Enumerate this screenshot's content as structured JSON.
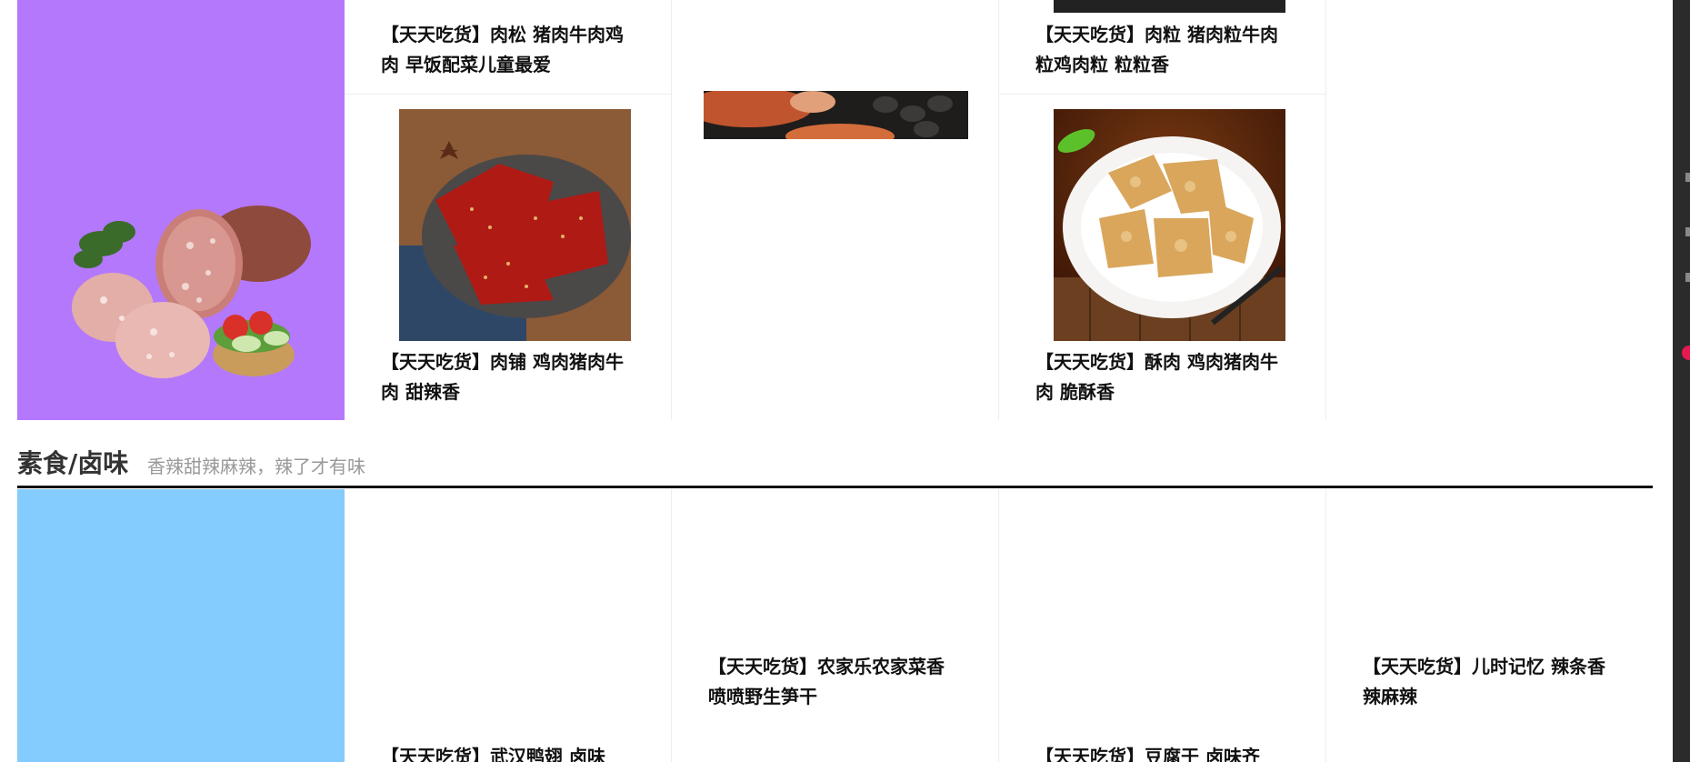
{
  "colors": {
    "promo_purple": "#b478fd",
    "promo_blue": "#84ccfd",
    "divider": "#111111",
    "subtitle_gray": "#999999"
  },
  "meat_section": {
    "products": [
      {
        "title": "【天天吃货】肉松 猪肉牛肉鸡肉 早饭配菜儿童最爱"
      },
      {
        "title": "【天天吃货】肉粒 猪肉粒牛肉粒鸡肉粒 粒粒香"
      },
      {
        "title": "【天天吃货】肉铺 鸡肉猪肉牛肉 甜辣香"
      },
      {
        "title": "【天天吃货】酥肉 鸡肉猪肉牛肉 脆酥香"
      }
    ]
  },
  "veg_section": {
    "title": "素食/卤味",
    "subtitle": "香辣甜辣麻辣，辣了才有味",
    "products": [
      {
        "title": "【天天吃货】武汉鸭翅 卤味"
      },
      {
        "title": "【天天吃货】农家乐农家菜香喷喷野生笋干"
      },
      {
        "title": "【天天吃货】豆腐干 卤味齐"
      },
      {
        "title": "【天天吃货】儿时记忆 辣条香辣麻辣"
      }
    ]
  }
}
